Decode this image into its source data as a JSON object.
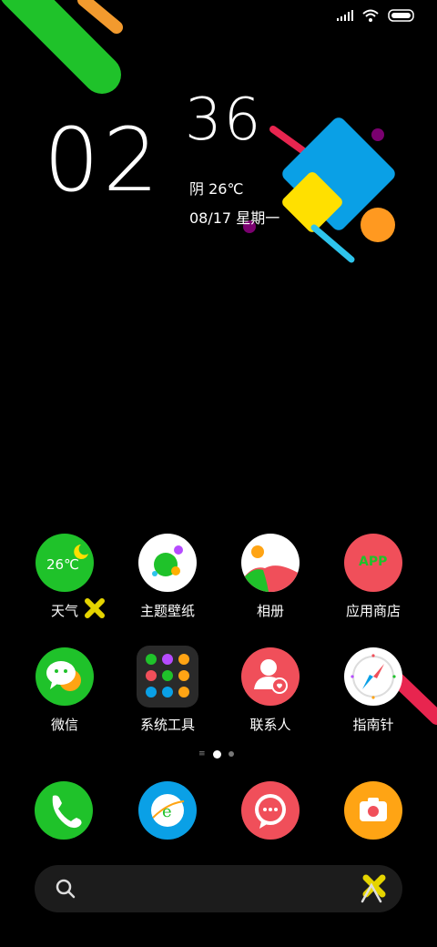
{
  "status_bar": {
    "signal_icon": "signal-icon",
    "wifi_icon": "wifi-icon",
    "battery_icon": "battery-icon"
  },
  "clock": {
    "hour": "02",
    "minute": "36",
    "weather": "阴  26℃",
    "date": "08/17  星期一"
  },
  "apps_row1": [
    {
      "label": "天气",
      "name": "weather",
      "icon_text": "26℃"
    },
    {
      "label": "主题壁纸",
      "name": "themes"
    },
    {
      "label": "相册",
      "name": "gallery"
    },
    {
      "label": "应用商店",
      "name": "app-store",
      "icon_text": "APP"
    }
  ],
  "apps_row2": [
    {
      "label": "微信",
      "name": "wechat"
    },
    {
      "label": "系统工具",
      "name": "system-tools"
    },
    {
      "label": "联系人",
      "name": "contacts"
    },
    {
      "label": "指南针",
      "name": "compass"
    }
  ],
  "dock": [
    "phone",
    "browser",
    "messages",
    "camera"
  ],
  "colors": {
    "green": "#1fc22a",
    "blue": "#0aa0e6",
    "red": "#f04f5a",
    "orange": "#ffa414",
    "yellow": "#ffe000",
    "pink": "#e8254f"
  }
}
